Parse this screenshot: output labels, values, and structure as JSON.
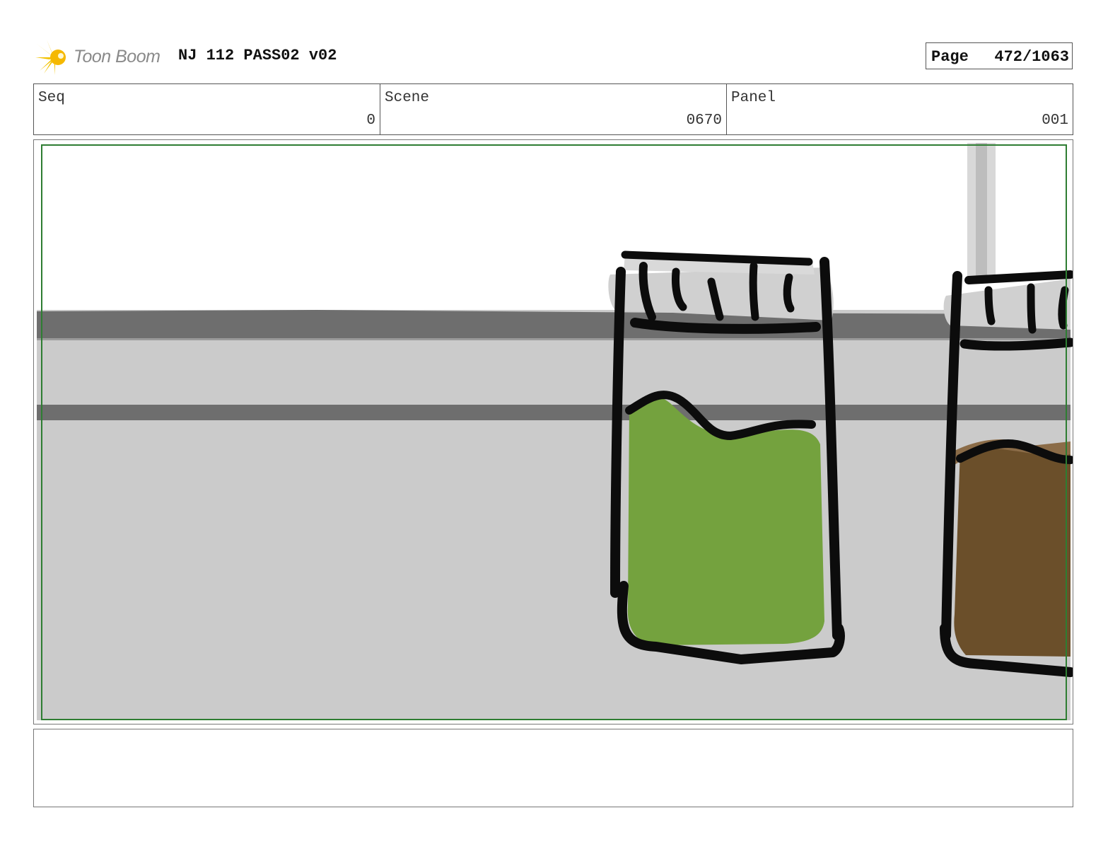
{
  "header": {
    "brand": "Toon Boom",
    "title": "NJ 112 PASS02 v02",
    "page_label": "Page",
    "page_value": "472/1063"
  },
  "fields": {
    "seq_label": "Seq",
    "seq_value": "0",
    "scene_label": "Scene",
    "scene_value": "0670",
    "panel_label": "Panel",
    "panel_value": "001"
  },
  "colors": {
    "accent_green": "#2e7d32",
    "liquid_green": "#74a23e",
    "liquid_brown": "#6b4f2a",
    "shelf_gray": "#cccccc",
    "shelf_dark": "#6e6e6e"
  },
  "notes": ""
}
